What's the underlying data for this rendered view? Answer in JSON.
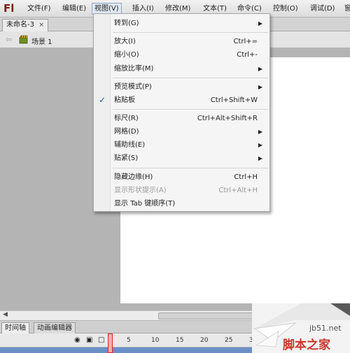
{
  "app": {
    "logo": "Fl"
  },
  "menubar": {
    "items": [
      {
        "label": "文件(F)"
      },
      {
        "label": "编辑(E)"
      },
      {
        "label": "视图(V)"
      },
      {
        "label": "插入(I)"
      },
      {
        "label": "修改(M)"
      },
      {
        "label": "文本(T)"
      },
      {
        "label": "命令(C)"
      },
      {
        "label": "控制(O)"
      },
      {
        "label": "调试(D)"
      },
      {
        "label": "窗"
      }
    ],
    "active": "视图(V)"
  },
  "document_tab": {
    "title": "未命名-3",
    "close_glyph": "×"
  },
  "editbar": {
    "scene_label": "场景 1"
  },
  "view_menu": {
    "items": [
      {
        "label": "转到(G)",
        "shortcut": "",
        "submenu": true
      },
      {
        "label": "放大(I)",
        "shortcut": "Ctrl+="
      },
      {
        "label": "缩小(O)",
        "shortcut": "Ctrl+-"
      },
      {
        "label": "缩放比率(M)",
        "shortcut": "",
        "submenu": true
      },
      {
        "label": "预览模式(P)",
        "shortcut": "",
        "submenu": true
      },
      {
        "label": "粘贴板",
        "shortcut": "Ctrl+Shift+W",
        "checked": true
      },
      {
        "label": "标尺(R)",
        "shortcut": "Ctrl+Alt+Shift+R"
      },
      {
        "label": "网格(D)",
        "shortcut": "",
        "submenu": true
      },
      {
        "label": "辅助线(E)",
        "shortcut": "",
        "submenu": true
      },
      {
        "label": "贴紧(S)",
        "shortcut": "",
        "submenu": true
      },
      {
        "label": "隐藏边缘(H)",
        "shortcut": "Ctrl+H"
      },
      {
        "label": "显示形状提示(A)",
        "shortcut": "Ctrl+Alt+H",
        "disabled": true
      },
      {
        "label": "显示 Tab 键顺序(T)",
        "shortcut": ""
      }
    ],
    "check_glyph": "✓",
    "submenu_glyph": "▶"
  },
  "timeline": {
    "tabs": [
      {
        "label": "时间轴",
        "active": true
      },
      {
        "label": "动画编辑器",
        "active": false
      }
    ],
    "ruler": [
      "1",
      "5",
      "10",
      "15",
      "20",
      "25",
      "30"
    ],
    "header_icons": [
      "eye-icon",
      "lock-icon",
      "outline-icon"
    ]
  },
  "watermark": {
    "url": "jb51.net",
    "name": "脚本之家"
  },
  "colors": {
    "menu_highlight": "#dfe8f2",
    "logo": "#7a1f12",
    "check": "#1f5fb7",
    "playhead": "#dd2222",
    "watermark_brand": "#c8372b"
  }
}
